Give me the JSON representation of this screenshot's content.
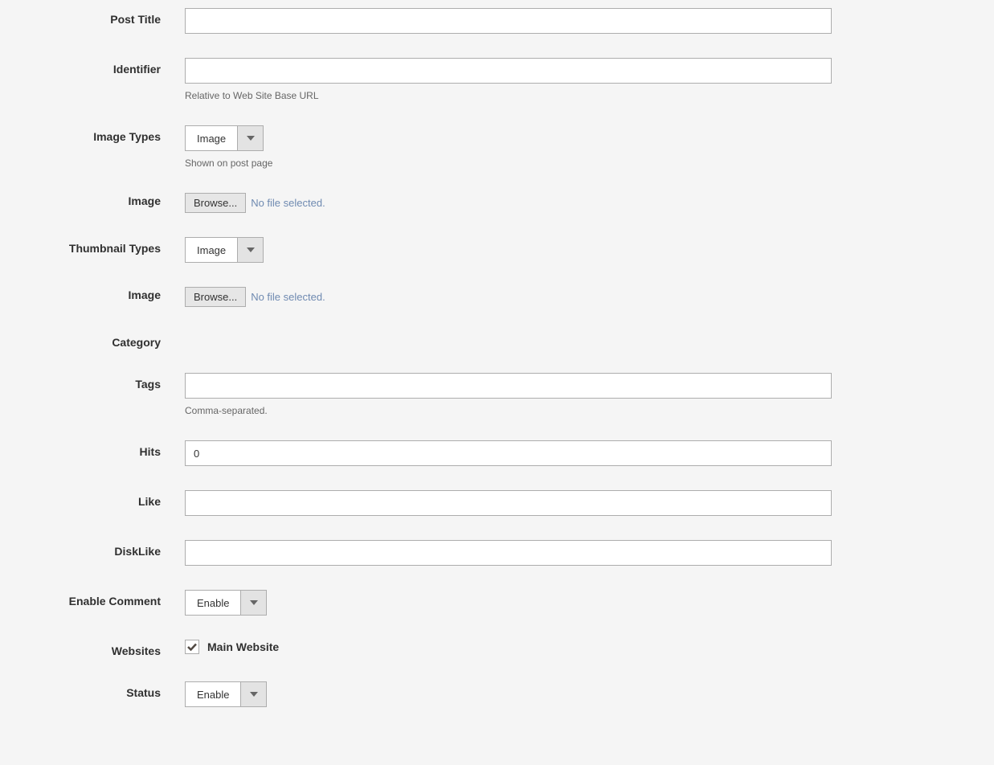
{
  "labels": {
    "post_title": "Post Title",
    "identifier": "Identifier",
    "image_types": "Image Types",
    "image": "Image",
    "thumbnail_types": "Thumbnail Types",
    "image2": "Image",
    "category": "Category",
    "tags": "Tags",
    "hits": "Hits",
    "like": "Like",
    "dislike": "DiskLike",
    "enable_comment": "Enable Comment",
    "websites": "Websites",
    "status": "Status"
  },
  "help": {
    "identifier": "Relative to Web Site Base URL",
    "image_types": "Shown on post page",
    "tags": "Comma-separated."
  },
  "values": {
    "post_title": "",
    "identifier": "",
    "image_types": "Image",
    "thumbnail_types": "Image",
    "tags": "",
    "hits": "0",
    "like": "",
    "dislike": "",
    "enable_comment": "Enable",
    "status": "Enable"
  },
  "file": {
    "browse": "Browse...",
    "no_file": "No file selected."
  },
  "websites": {
    "main": "Main Website"
  }
}
